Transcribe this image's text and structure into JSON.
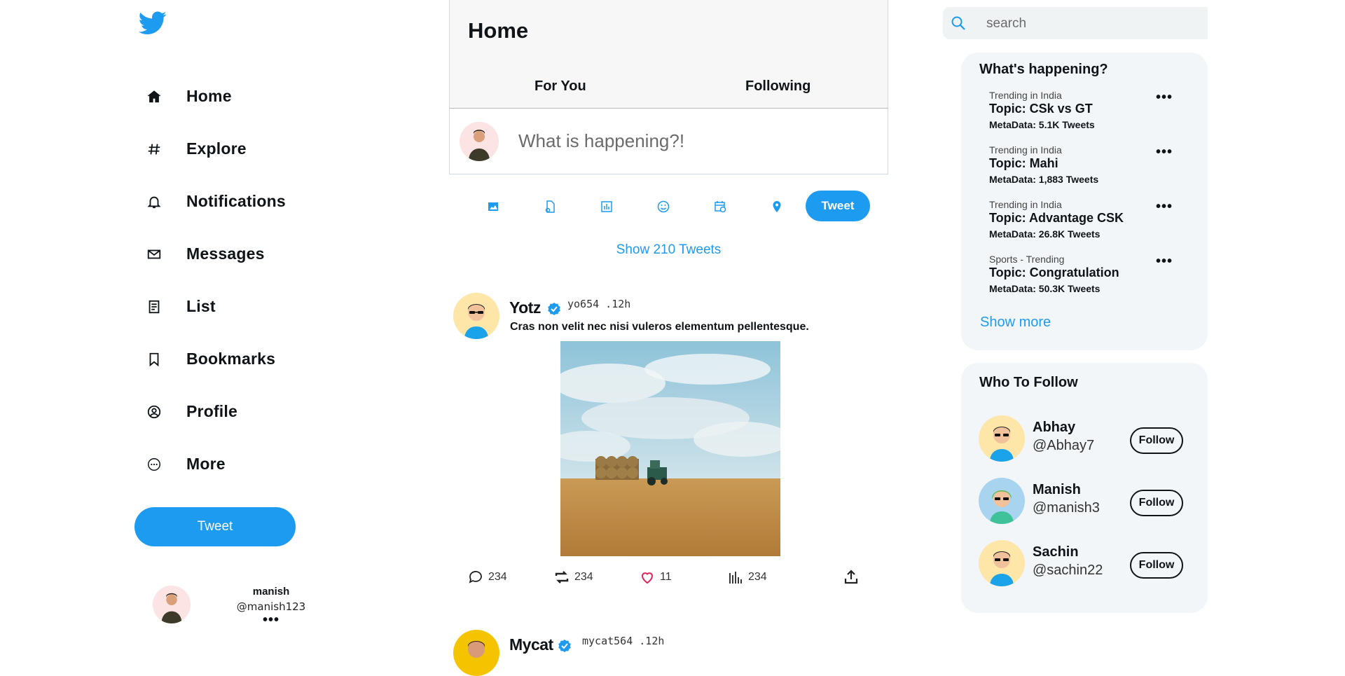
{
  "colors": {
    "accent": "#1d9bf0",
    "panel": "#f3f6f9",
    "text": "#0f1419"
  },
  "sidebar": {
    "logo_icon": "twitter-bird-icon",
    "items": [
      {
        "label": "Home",
        "icon": "home-icon"
      },
      {
        "label": "Explore",
        "icon": "hash-icon"
      },
      {
        "label": "Notifications",
        "icon": "bell-icon"
      },
      {
        "label": "Messages",
        "icon": "mail-icon"
      },
      {
        "label": "List",
        "icon": "list-icon"
      },
      {
        "label": "Bookmarks",
        "icon": "bookmark-icon"
      },
      {
        "label": "Profile",
        "icon": "profile-icon"
      },
      {
        "label": "More",
        "icon": "more-circle-icon"
      }
    ],
    "tweet_label": "Tweet",
    "account": {
      "name": "manish",
      "handle": "@manish123",
      "more": "•••"
    }
  },
  "main": {
    "title": "Home",
    "tabs": [
      {
        "label": "For You"
      },
      {
        "label": "Following"
      }
    ],
    "composer": {
      "placeholder": "What is happening?!"
    },
    "tools": [
      "image-icon",
      "gif-icon",
      "poll-icon",
      "emoji-icon",
      "schedule-icon",
      "location-icon"
    ],
    "tweet_button": "Tweet",
    "show_tweets": "Show 210 Tweets",
    "tweets": [
      {
        "name": "Yotz",
        "handle_time": "yo654 .12h",
        "text": "Cras non velit nec nisi vuleros elementum pellentesque.",
        "stats": {
          "replies": "234",
          "retweets": "234",
          "likes": "11",
          "views": "234"
        }
      },
      {
        "name": "Mycat",
        "handle_time": "mycat564 .12h"
      }
    ]
  },
  "search": {
    "placeholder": "search"
  },
  "whats_happening": {
    "title": "What's happening?",
    "trends": [
      {
        "category": "Trending in India",
        "topic": "Topic: CSk vs GT",
        "meta": "MetaData: 5.1K Tweets",
        "more": "•••"
      },
      {
        "category": "Trending in India",
        "topic": "Topic: Mahi",
        "meta": "MetaData: 1,883 Tweets",
        "more": "•••"
      },
      {
        "category": "Trending in India",
        "topic": "Topic: Advantage CSK",
        "meta": "MetaData: 26.8K Tweets",
        "more": "•••"
      },
      {
        "category": "Sports - Trending",
        "topic": "Topic: Congratulation",
        "meta": "MetaData: 50.3K Tweets",
        "more": "•••"
      }
    ],
    "show_more": "Show more"
  },
  "who_to_follow": {
    "title": "Who To Follow",
    "users": [
      {
        "name": "Abhay",
        "handle": "@Abhay7",
        "button": "Follow"
      },
      {
        "name": "Manish",
        "handle": "@manish3",
        "button": "Follow"
      },
      {
        "name": "Sachin",
        "handle": "@sachin22",
        "button": "Follow"
      }
    ]
  }
}
